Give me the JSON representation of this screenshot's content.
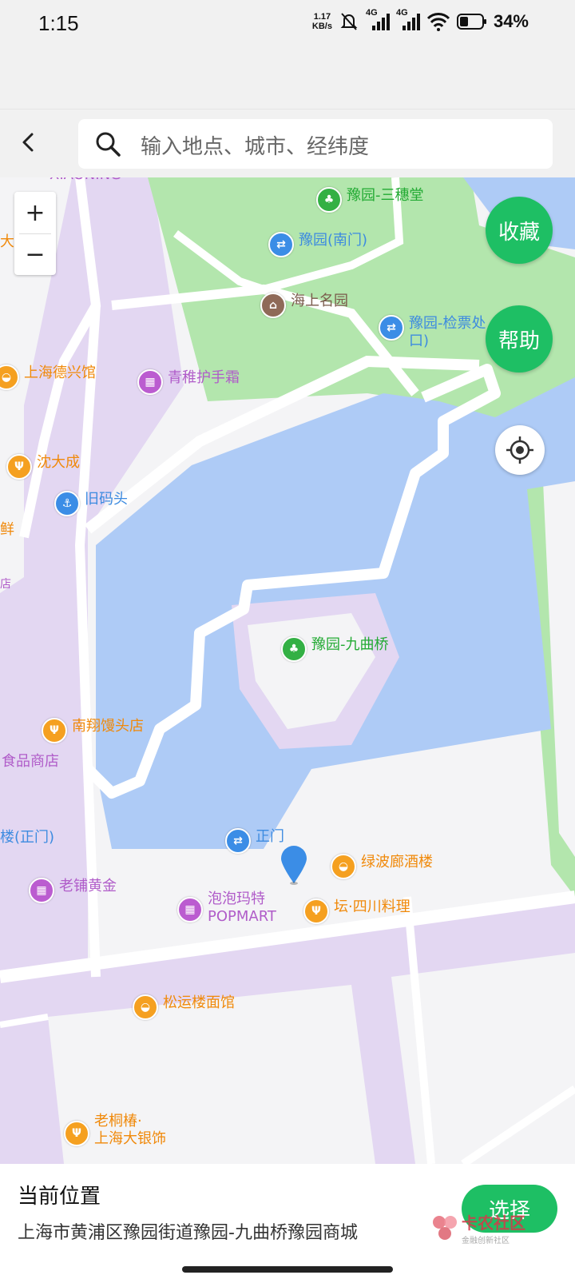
{
  "status_bar": {
    "time": "1:15",
    "net_speed_value": "1.17",
    "net_speed_unit": "KB/s",
    "network_1": "4G",
    "network_2": "4G",
    "battery_pct": "34%"
  },
  "header": {
    "search_placeholder": "输入地点、城市、经纬度"
  },
  "map": {
    "controls": {
      "zoom_in": "+",
      "zoom_out": "−",
      "favorite_label": "收藏",
      "help_label": "帮助"
    },
    "edge_labels": {
      "top_left_partial": "XIAONING",
      "left_partial_1": "大",
      "left_partial_2": "鲜",
      "left_partial_3": "店",
      "left_partial_4": "食品商店",
      "left_partial_5": "楼(正门)"
    },
    "pois": [
      {
        "key": "sansui",
        "label": "豫园-三穗堂",
        "color": "green"
      },
      {
        "key": "southgate",
        "label": "豫园(南门)",
        "color": "blue"
      },
      {
        "key": "haishang",
        "label": "海上名园",
        "color": "brown"
      },
      {
        "key": "ticket",
        "label": "豫园-检票处",
        "label2": "口)",
        "color": "blue"
      },
      {
        "key": "dexing",
        "label": "上海德兴馆",
        "color": "orange"
      },
      {
        "key": "qingzhi",
        "label": "青稚护手霜",
        "color": "purple"
      },
      {
        "key": "shendacheng",
        "label": "沈大成",
        "color": "orange"
      },
      {
        "key": "jiumatou",
        "label": "旧码头",
        "color": "blue"
      },
      {
        "key": "jiuqu",
        "label": "豫园-九曲桥",
        "color": "green"
      },
      {
        "key": "nanxiang",
        "label": "南翔馒头店",
        "color": "orange"
      },
      {
        "key": "zhengmen",
        "label": "正门",
        "color": "blue"
      },
      {
        "key": "lvbolang",
        "label": "绿波廊酒楼",
        "color": "orange"
      },
      {
        "key": "laopu",
        "label": "老铺黄金",
        "color": "purple"
      },
      {
        "key": "popmart",
        "label": "泡泡玛特",
        "label2": "POPMART",
        "color": "purple"
      },
      {
        "key": "sichuan",
        "label": "坛·四川料理",
        "color": "orange"
      },
      {
        "key": "songyun",
        "label": "松运楼面馆",
        "color": "orange"
      },
      {
        "key": "laotong",
        "label": "老桐椿·",
        "label2": "上海大银饰",
        "color": "orange"
      }
    ]
  },
  "bottom_panel": {
    "title": "当前位置",
    "address": "上海市黄浦区豫园街道豫园-九曲桥豫园商城",
    "select_label": "选择",
    "watermark_text": "卡农社区",
    "watermark_sub": "金融创新社区"
  }
}
